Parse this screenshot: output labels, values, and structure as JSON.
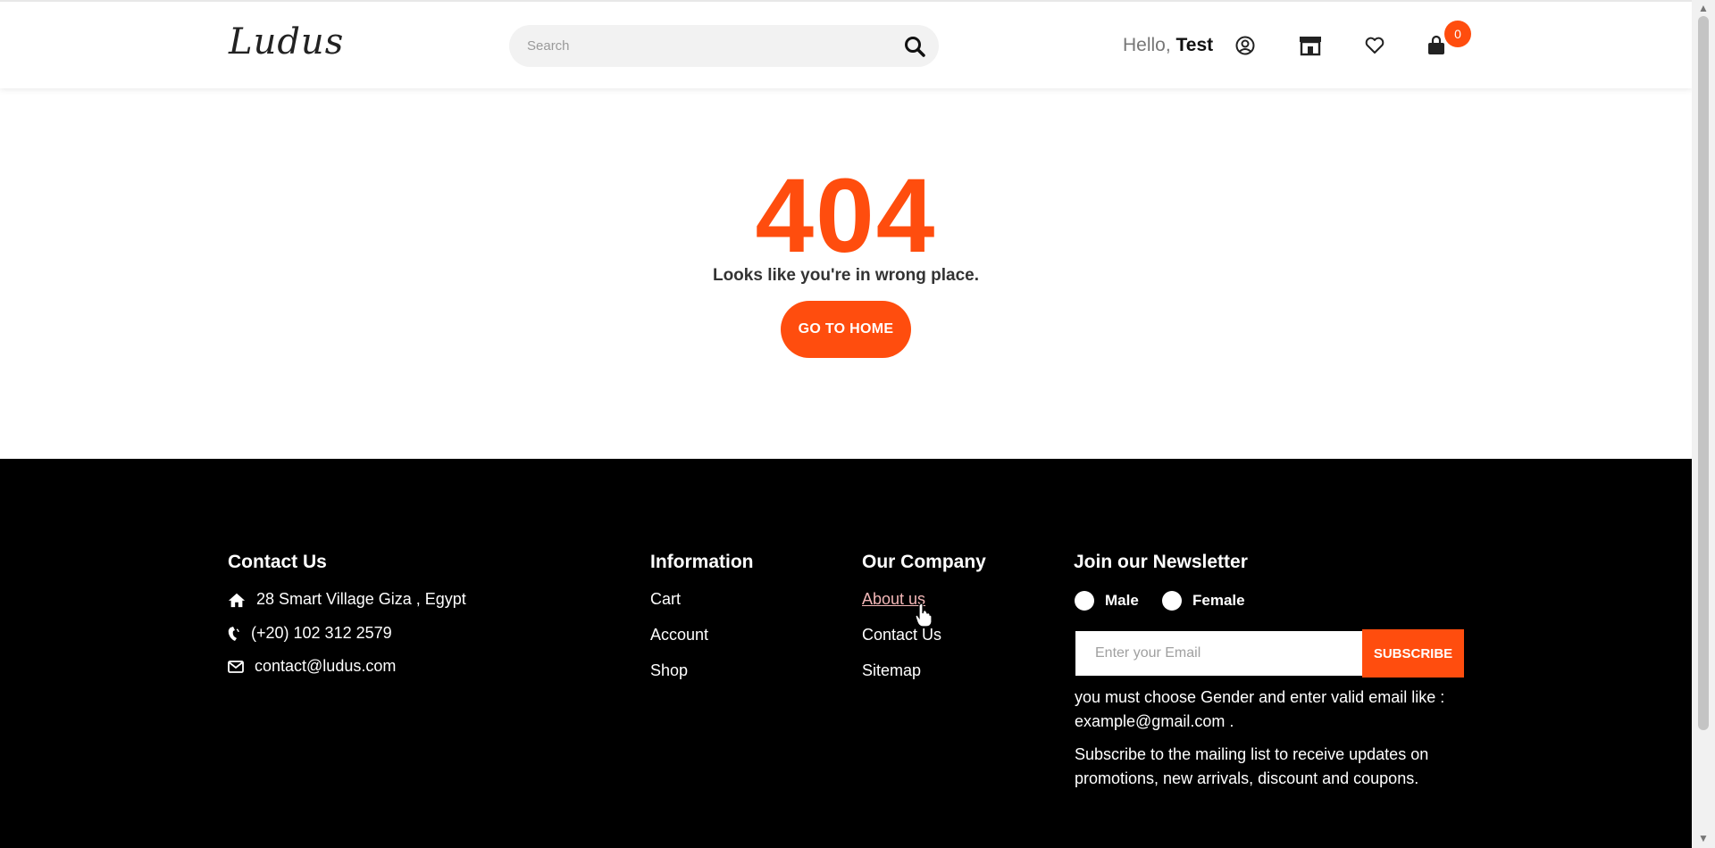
{
  "header": {
    "logo": "Ludus",
    "search_placeholder": "Search",
    "greeting_prefix": "Hello, ",
    "user_name": "Test",
    "cart_count": "0"
  },
  "main": {
    "error_code": "404",
    "message": "Looks like you're in wrong place.",
    "home_button": "GO TO HOME"
  },
  "footer": {
    "contact": {
      "title": "Contact Us",
      "address": "28 Smart Village Giza , Egypt",
      "phone": "(+20) 102 312 2579",
      "email": "contact@ludus.com"
    },
    "information": {
      "title": "Information",
      "links": [
        "Cart",
        "Account",
        "Shop"
      ]
    },
    "company": {
      "title": "Our Company",
      "links": [
        "About us",
        "Contact Us",
        "Sitemap"
      ]
    },
    "newsletter": {
      "title": "Join our Newsletter",
      "gender_male": "Male",
      "gender_female": "Female",
      "email_placeholder": "Enter your Email",
      "subscribe_label": "SUBSCRIBE",
      "validation_note": "you must choose Gender and enter valid email like : example@gmail.com .",
      "description": "Subscribe to the mailing list to receive updates on promotions, new arrivals, discount and coupons."
    }
  },
  "colors": {
    "accent": "#ff4d0e",
    "footer_bg": "#000000",
    "link_hover": "#f3b7b7"
  }
}
